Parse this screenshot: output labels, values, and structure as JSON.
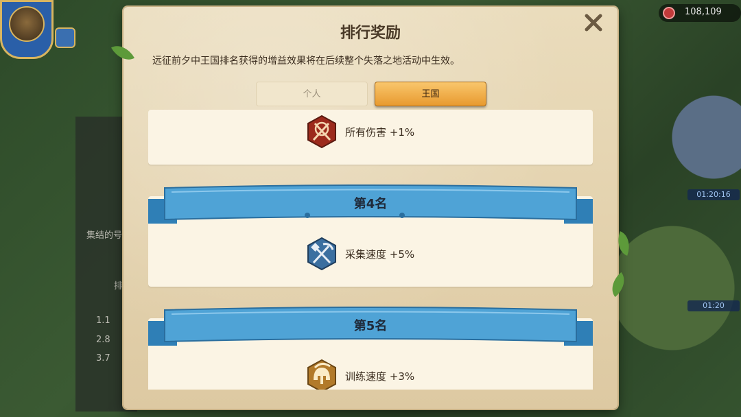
{
  "background": {
    "resource_count": "108,109",
    "left_panel_rows": [
      "集结的号",
      "排",
      "1.1",
      "2.8",
      "3.7"
    ],
    "timers": [
      "01:20:16",
      "01:20"
    ]
  },
  "dialog": {
    "title": "排行奖励",
    "description": "远征前夕中王国排名获得的增益效果将在后续整个失落之地活动中生效。",
    "close_icon": "close-icon",
    "tabs": [
      {
        "label": "个人",
        "active": false
      },
      {
        "label": "王国",
        "active": true
      }
    ],
    "rewards": [
      {
        "rank": "",
        "icon": "crossed-swords-icon",
        "effect": "所有伤害 +1%"
      },
      {
        "rank": "第4名",
        "icon": "pickaxe-shovel-icon",
        "effect": "采集速度 +5%"
      },
      {
        "rank": "第5名",
        "icon": "spartan-helmet-icon",
        "effect": "训练速度 +3%"
      }
    ]
  },
  "colors": {
    "parchment": "#eadcbc",
    "card": "#fbf4e4",
    "active_tab": "#f0ae48",
    "ribbon": "#4fa3d6",
    "damage_icon": "#9c2a1c",
    "gather_icon": "#3b6fa0",
    "train_icon": "#b27a2a"
  }
}
